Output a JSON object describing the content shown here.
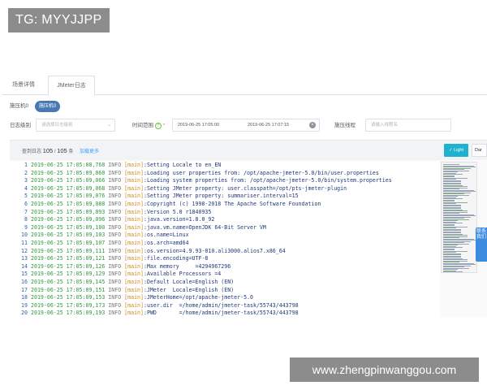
{
  "watermarks": {
    "top": "TG: MYYJJPP",
    "bottom": "www.zhengpinwanggou.com"
  },
  "tabs": [
    {
      "label": "场景详情",
      "active": false
    },
    {
      "label": "JMeter日志",
      "active": true
    }
  ],
  "machine": {
    "label": "施压机0",
    "chip": "施压机0"
  },
  "filters": {
    "level_label": "日志级别",
    "level_placeholder": "请选择日志级别",
    "time_label": "时间范围",
    "required_mark": "*",
    "help_icon": "?",
    "time_start": "2019-06-25 17:05:00",
    "time_end": "2019-06-25 17:07:15",
    "thread_label": "施压线程",
    "thread_placeholder": "请输入线程名"
  },
  "log_header": {
    "prefix": "查到日志",
    "shown": "105",
    "separator": "/",
    "total": "105",
    "suffix": "条",
    "more_link": "加载更多",
    "light_button": "Light",
    "dark_button": "Dar"
  },
  "sidebar_text": "联系我们",
  "colors": {
    "timestamp": "#2e9a3c",
    "thread": "#d08a1a",
    "message": "#1f3a7a",
    "line_number": "#2f5fa8",
    "accent": "#1fb2d0",
    "chip": "#4a78b5"
  },
  "log_lines": [
    {
      "n": "1",
      "ts": "2019-06-25 17:05:08,768",
      "level": "INFO",
      "thread": "[main]",
      "msg": ":Setting Locale to en_EN"
    },
    {
      "n": "2",
      "ts": "2019-06-25 17:05:09,060",
      "level": "INFO",
      "thread": "[main]",
      "msg": ":Loading user properties from: /opt/apache-jmeter-5.0/bin/user.properties"
    },
    {
      "n": "3",
      "ts": "2019-06-25 17:05:09,066",
      "level": "INFO",
      "thread": "[main]",
      "msg": ":Loading system properties from: /opt/apache-jmeter-5.0/bin/system.properties"
    },
    {
      "n": "4",
      "ts": "2019-06-25 17:05:09,068",
      "level": "INFO",
      "thread": "[main]",
      "msg": ":Setting JMeter property: user.classpath=/opt/pts-jmeter-plugin"
    },
    {
      "n": "5",
      "ts": "2019-06-25 17:05:09,076",
      "level": "INFO",
      "thread": "[main]",
      "msg": ":Setting JMeter property: summariser.interval=15"
    },
    {
      "n": "6",
      "ts": "2019-06-25 17:05:09,088",
      "level": "INFO",
      "thread": "[main]",
      "msg": ":Copyright (c) 1998-2018 The Apache Software Foundation"
    },
    {
      "n": "7",
      "ts": "2019-06-25 17:05:09,093",
      "level": "INFO",
      "thread": "[main]",
      "msg": ":Version 5.0 r1840935"
    },
    {
      "n": "8",
      "ts": "2019-06-25 17:05:09,096",
      "level": "INFO",
      "thread": "[main]",
      "msg": ":java.version=1.8.0_92"
    },
    {
      "n": "9",
      "ts": "2019-06-25 17:05:09,100",
      "level": "INFO",
      "thread": "[main]",
      "msg": ":java.vm.name=OpenJDK 64-Bit Server VM"
    },
    {
      "n": "10",
      "ts": "2019-06-25 17:05:09,103",
      "level": "INFO",
      "thread": "[main]",
      "msg": ":os.name=Linux"
    },
    {
      "n": "11",
      "ts": "2019-06-25 17:05:09,107",
      "level": "INFO",
      "thread": "[main]",
      "msg": ":os.arch=amd64"
    },
    {
      "n": "12",
      "ts": "2019-06-25 17:05:09,111",
      "level": "INFO",
      "thread": "[main]",
      "msg": ":os.version=4.9.93-010.ali3000.alios7.x86_64"
    },
    {
      "n": "13",
      "ts": "2019-06-25 17:05:09,121",
      "level": "INFO",
      "thread": "[main]",
      "msg": ":file.encoding=UTF-8"
    },
    {
      "n": "14",
      "ts": "2019-06-25 17:05:09,126",
      "level": "INFO",
      "thread": "[main]",
      "msg": ":Max memory     =4294967296"
    },
    {
      "n": "15",
      "ts": "2019-06-25 17:05:09,129",
      "level": "INFO",
      "thread": "[main]",
      "msg": ":Available Processors =4"
    },
    {
      "n": "16",
      "ts": "2019-06-25 17:05:09,145",
      "level": "INFO",
      "thread": "[main]",
      "msg": ":Default Locale=English (EN)"
    },
    {
      "n": "17",
      "ts": "2019-06-25 17:05:09,151",
      "level": "INFO",
      "thread": "[main]",
      "msg": ":JMeter  Locale=English (EN)"
    },
    {
      "n": "18",
      "ts": "2019-06-25 17:05:09,153",
      "level": "INFO",
      "thread": "[main]",
      "msg": ":JMeterHome=/opt/apache-jmeter-5.0"
    },
    {
      "n": "19",
      "ts": "2019-06-25 17:05:09,173",
      "level": "INFO",
      "thread": "[main]",
      "msg": ":user.dir  =/home/admin/jmeter-task/55743/443798"
    },
    {
      "n": "20",
      "ts": "2019-06-25 17:05:09,193",
      "level": "INFO",
      "thread": "[main]",
      "msg": ":PWD       =/home/admin/jmeter-task/55743/443798"
    }
  ]
}
